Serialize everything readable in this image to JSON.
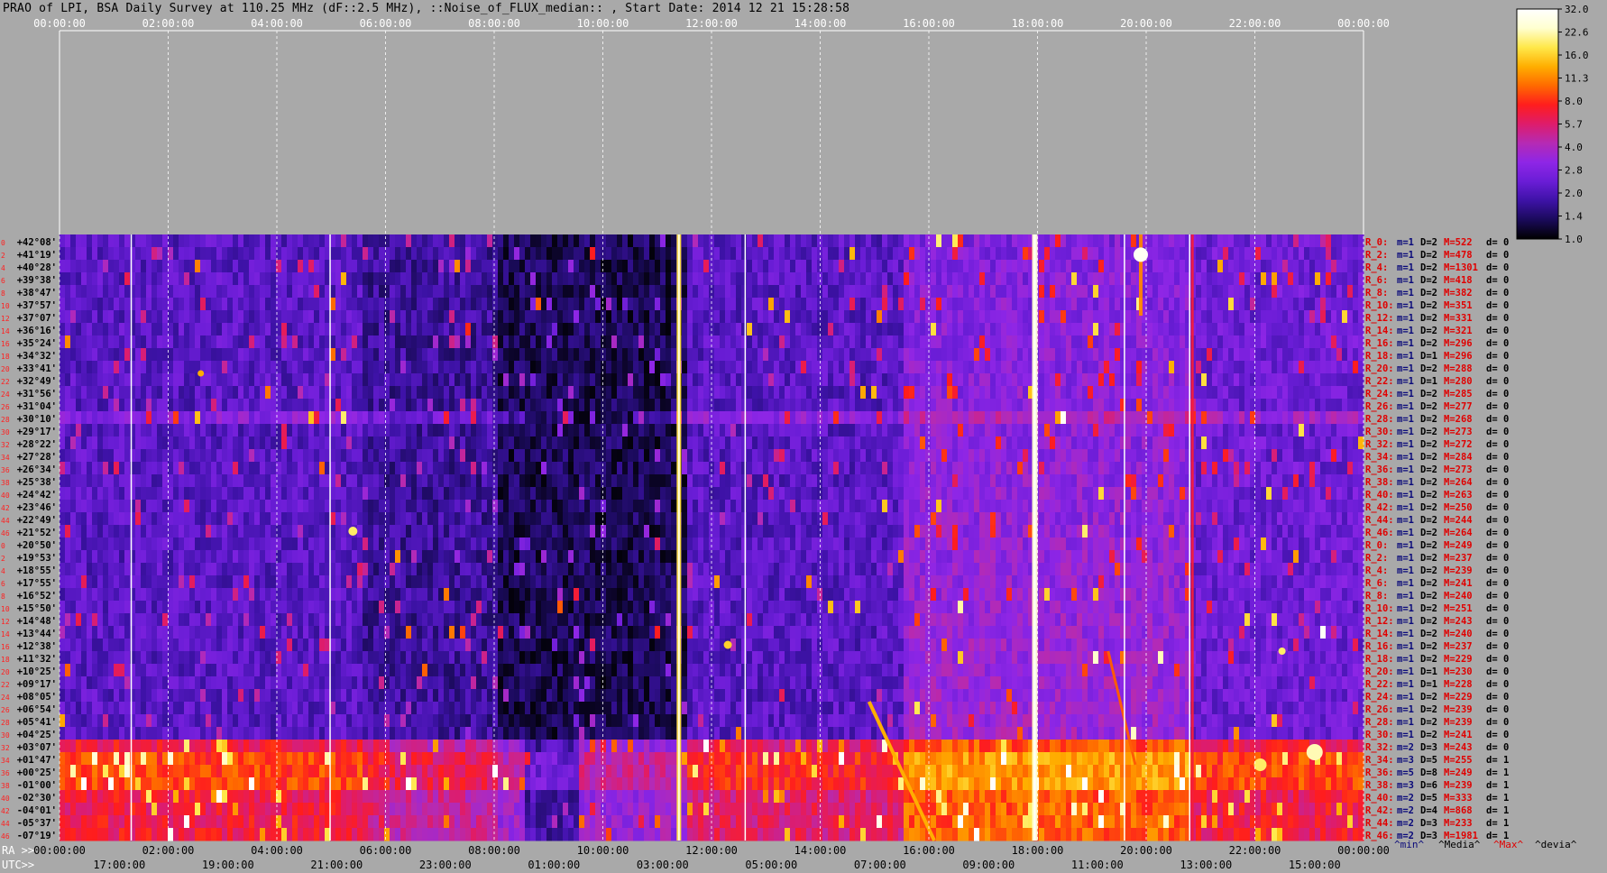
{
  "title": "PRAO of LPI, BSA Daily Survey at 110.25 MHz (dF::2.5 MHz), ::Noise_of_FLUX_median:: , Start Date: 2014 12 21 15:28:58",
  "chart_data": {
    "type": "heatmap",
    "title": "PRAO of LPI, BSA Daily Survey at 110.25 MHz (dF::2.5 MHz), ::Noise_of_FLUX_median:: , Start Date: 2014 12 21 15:28:58",
    "top_ticks": [
      "00:00:00",
      "02:00:00",
      "04:00:00",
      "06:00:00",
      "08:00:00",
      "10:00:00",
      "12:00:00",
      "14:00:00",
      "16:00:00",
      "18:00:00",
      "20:00:00",
      "22:00:00",
      "00:00:00"
    ],
    "ra_label": "RA >>",
    "ra_ticks": [
      "00:00:00",
      "02:00:00",
      "04:00:00",
      "06:00:00",
      "08:00:00",
      "10:00:00",
      "12:00:00",
      "14:00:00",
      "16:00:00",
      "18:00:00",
      "20:00:00",
      "22:00:00",
      "00:00:00"
    ],
    "utc_label": "UTC>>",
    "utc_ticks": [
      "17:00:00",
      "19:00:00",
      "21:00:00",
      "23:00:00",
      "01:00:00",
      "03:00:00",
      "05:00:00",
      "07:00:00",
      "09:00:00",
      "11:00:00",
      "13:00:00",
      "15:00:00"
    ],
    "declinations": [
      "+42°08'",
      "+41°19'",
      "+40°28'",
      "+39°38'",
      "+38°47'",
      "+37°57'",
      "+37°07'",
      "+36°16'",
      "+35°24'",
      "+34°32'",
      "+33°41'",
      "+32°49'",
      "+31°56'",
      "+31°04'",
      "+30°10'",
      "+29°17'",
      "+28°22'",
      "+27°28'",
      "+26°34'",
      "+25°38'",
      "+24°42'",
      "+23°46'",
      "+22°49'",
      "+21°52'",
      "+20°50'",
      "+19°53'",
      "+18°55'",
      "+17°55'",
      "+16°52'",
      "+15°50'",
      "+14°48'",
      "+13°44'",
      "+12°38'",
      "+11°32'",
      "+10°25'",
      "+09°17'",
      "+08°05'",
      "+06°54'",
      "+05°41'",
      "+04°25'",
      "+03°07'",
      "+01°47'",
      "+00°25'",
      "-01°00'",
      "-02°30'",
      "-04°01'",
      "-05°37'",
      "-07°19'"
    ],
    "row_numbers": [
      "0",
      "2",
      "4",
      "6",
      "8",
      "10",
      "12",
      "14",
      "16",
      "18",
      "20",
      "22",
      "24",
      "26",
      "28",
      "30",
      "32",
      "34",
      "36",
      "38",
      "40",
      "42",
      "44",
      "46",
      "0",
      "2",
      "4",
      "6",
      "8",
      "10",
      "12",
      "14",
      "16",
      "18",
      "20",
      "22",
      "24",
      "26",
      "28",
      "30",
      "32",
      "34",
      "36",
      "38",
      "40",
      "42",
      "44",
      "46"
    ],
    "colorbar": {
      "ticks": [
        "32.0",
        "22.6",
        "16.0",
        "11.3",
        "8.0",
        "5.7",
        "4.0",
        "2.8",
        "2.0",
        "1.4",
        "1.0"
      ],
      "colors": [
        "#000000",
        "#1a0a5a",
        "#3d12a6",
        "#6a1dd6",
        "#8e26e6",
        "#b52ab4",
        "#de1c6b",
        "#ff1d1d",
        "#ff6a00",
        "#ffae00",
        "#ffe84a",
        "#ffffd0",
        "#ffffff"
      ]
    },
    "right_table": {
      "header": [
        "^min^",
        "^Media^",
        "^Max^",
        "^devia^"
      ],
      "rows": [
        {
          "beam": "R_0:",
          "m": "m=1",
          "d": "D=2",
          "mx": "M=522",
          "dv": "d= 0"
        },
        {
          "beam": "R_2:",
          "m": "m=1",
          "d": "D=2",
          "mx": "M=478",
          "dv": "d= 0"
        },
        {
          "beam": "R_4:",
          "m": "m=1",
          "d": "D=2",
          "mx": "M=1301",
          "dv": "d= 0"
        },
        {
          "beam": "R_6:",
          "m": "m=1",
          "d": "D=2",
          "mx": "M=418",
          "dv": "d= 0"
        },
        {
          "beam": "R_8:",
          "m": "m=1",
          "d": "D=2",
          "mx": "M=382",
          "dv": "d= 0"
        },
        {
          "beam": "R_10:",
          "m": "m=1",
          "d": "D=2",
          "mx": "M=351",
          "dv": "d= 0"
        },
        {
          "beam": "R_12:",
          "m": "m=1",
          "d": "D=2",
          "mx": "M=331",
          "dv": "d= 0"
        },
        {
          "beam": "R_14:",
          "m": "m=1",
          "d": "D=2",
          "mx": "M=321",
          "dv": "d= 0"
        },
        {
          "beam": "R_16:",
          "m": "m=1",
          "d": "D=2",
          "mx": "M=296",
          "dv": "d= 0"
        },
        {
          "beam": "R_18:",
          "m": "m=1",
          "d": "D=1",
          "mx": "M=296",
          "dv": "d= 0"
        },
        {
          "beam": "R_20:",
          "m": "m=1",
          "d": "D=2",
          "mx": "M=288",
          "dv": "d= 0"
        },
        {
          "beam": "R_22:",
          "m": "m=1",
          "d": "D=1",
          "mx": "M=280",
          "dv": "d= 0"
        },
        {
          "beam": "R_24:",
          "m": "m=1",
          "d": "D=2",
          "mx": "M=285",
          "dv": "d= 0"
        },
        {
          "beam": "R_26:",
          "m": "m=1",
          "d": "D=2",
          "mx": "M=277",
          "dv": "d= 0"
        },
        {
          "beam": "R_28:",
          "m": "m=1",
          "d": "D=2",
          "mx": "M=268",
          "dv": "d= 0"
        },
        {
          "beam": "R_30:",
          "m": "m=1",
          "d": "D=2",
          "mx": "M=273",
          "dv": "d= 0"
        },
        {
          "beam": "R_32:",
          "m": "m=1",
          "d": "D=2",
          "mx": "M=272",
          "dv": "d= 0"
        },
        {
          "beam": "R_34:",
          "m": "m=1",
          "d": "D=2",
          "mx": "M=284",
          "dv": "d= 0"
        },
        {
          "beam": "R_36:",
          "m": "m=1",
          "d": "D=2",
          "mx": "M=273",
          "dv": "d= 0"
        },
        {
          "beam": "R_38:",
          "m": "m=1",
          "d": "D=2",
          "mx": "M=264",
          "dv": "d= 0"
        },
        {
          "beam": "R_40:",
          "m": "m=1",
          "d": "D=2",
          "mx": "M=263",
          "dv": "d= 0"
        },
        {
          "beam": "R_42:",
          "m": "m=1",
          "d": "D=2",
          "mx": "M=250",
          "dv": "d= 0"
        },
        {
          "beam": "R_44:",
          "m": "m=1",
          "d": "D=2",
          "mx": "M=244",
          "dv": "d= 0"
        },
        {
          "beam": "R_46:",
          "m": "m=1",
          "d": "D=2",
          "mx": "M=264",
          "dv": "d= 0"
        },
        {
          "beam": "R_0:",
          "m": "m=1",
          "d": "D=2",
          "mx": "M=249",
          "dv": "d= 0"
        },
        {
          "beam": "R_2:",
          "m": "m=1",
          "d": "D=2",
          "mx": "M=237",
          "dv": "d= 0"
        },
        {
          "beam": "R_4:",
          "m": "m=1",
          "d": "D=2",
          "mx": "M=239",
          "dv": "d= 0"
        },
        {
          "beam": "R_6:",
          "m": "m=1",
          "d": "D=2",
          "mx": "M=241",
          "dv": "d= 0"
        },
        {
          "beam": "R_8:",
          "m": "m=1",
          "d": "D=2",
          "mx": "M=240",
          "dv": "d= 0"
        },
        {
          "beam": "R_10:",
          "m": "m=1",
          "d": "D=2",
          "mx": "M=251",
          "dv": "d= 0"
        },
        {
          "beam": "R_12:",
          "m": "m=1",
          "d": "D=2",
          "mx": "M=243",
          "dv": "d= 0"
        },
        {
          "beam": "R_14:",
          "m": "m=1",
          "d": "D=2",
          "mx": "M=240",
          "dv": "d= 0"
        },
        {
          "beam": "R_16:",
          "m": "m=1",
          "d": "D=2",
          "mx": "M=237",
          "dv": "d= 0"
        },
        {
          "beam": "R_18:",
          "m": "m=1",
          "d": "D=2",
          "mx": "M=229",
          "dv": "d= 0"
        },
        {
          "beam": "R_20:",
          "m": "m=1",
          "d": "D=1",
          "mx": "M=230",
          "dv": "d= 0"
        },
        {
          "beam": "R_22:",
          "m": "m=1",
          "d": "D=1",
          "mx": "M=228",
          "dv": "d= 0"
        },
        {
          "beam": "R_24:",
          "m": "m=1",
          "d": "D=2",
          "mx": "M=229",
          "dv": "d= 0"
        },
        {
          "beam": "R_26:",
          "m": "m=1",
          "d": "D=2",
          "mx": "M=239",
          "dv": "d= 0"
        },
        {
          "beam": "R_28:",
          "m": "m=1",
          "d": "D=2",
          "mx": "M=239",
          "dv": "d= 0"
        },
        {
          "beam": "R_30:",
          "m": "m=1",
          "d": "D=2",
          "mx": "M=241",
          "dv": "d= 0"
        },
        {
          "beam": "R_32:",
          "m": "m=2",
          "d": "D=3",
          "mx": "M=243",
          "dv": "d= 0"
        },
        {
          "beam": "R_34:",
          "m": "m=3",
          "d": "D=5",
          "mx": "M=255",
          "dv": "d= 1"
        },
        {
          "beam": "R_36:",
          "m": "m=5",
          "d": "D=8",
          "mx": "M=249",
          "dv": "d= 1"
        },
        {
          "beam": "R_38:",
          "m": "m=3",
          "d": "D=6",
          "mx": "M=239",
          "dv": "d= 1"
        },
        {
          "beam": "R_40:",
          "m": "m=2",
          "d": "D=5",
          "mx": "M=333",
          "dv": "d= 1"
        },
        {
          "beam": "R_42:",
          "m": "m=2",
          "d": "D=4",
          "mx": "M=868",
          "dv": "d= 1"
        },
        {
          "beam": "R_44:",
          "m": "m=2",
          "d": "D=3",
          "mx": "M=233",
          "dv": "d= 1"
        },
        {
          "beam": "R_46:",
          "m": "m=2",
          "d": "D=3",
          "mx": "M=1981",
          "dv": "d= 1"
        }
      ]
    }
  }
}
